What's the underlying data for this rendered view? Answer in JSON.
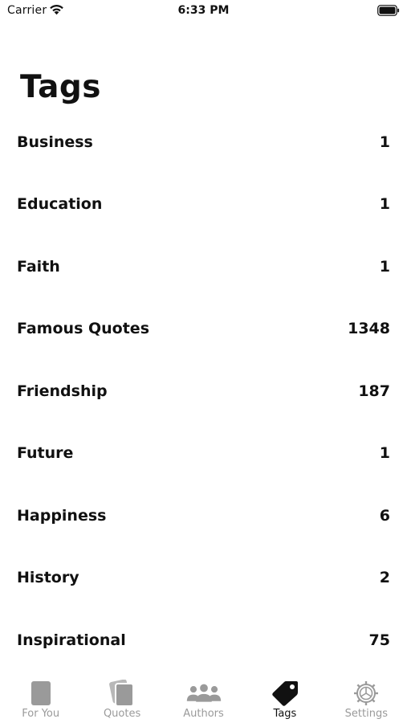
{
  "status_bar": {
    "carrier": "Carrier",
    "time": "6:33 PM"
  },
  "page": {
    "title": "Tags"
  },
  "tags": [
    {
      "name": "Business",
      "count": "1"
    },
    {
      "name": "Education",
      "count": "1"
    },
    {
      "name": "Faith",
      "count": "1"
    },
    {
      "name": "Famous Quotes",
      "count": "1348"
    },
    {
      "name": "Friendship",
      "count": "187"
    },
    {
      "name": "Future",
      "count": "1"
    },
    {
      "name": "Happiness",
      "count": "6"
    },
    {
      "name": "History",
      "count": "2"
    },
    {
      "name": "Inspirational",
      "count": "75"
    }
  ],
  "tab_bar": {
    "tabs": [
      {
        "label": "For You",
        "icon": "card-icon",
        "active": false
      },
      {
        "label": "Quotes",
        "icon": "stacked-cards-icon",
        "active": false
      },
      {
        "label": "Authors",
        "icon": "people-icon",
        "active": false
      },
      {
        "label": "Tags",
        "icon": "tag-icon",
        "active": true
      },
      {
        "label": "Settings",
        "icon": "gear-icon",
        "active": false
      }
    ]
  },
  "colors": {
    "active_tab": "#111111",
    "inactive_tab": "#9a9a9a",
    "background": "#ffffff"
  }
}
